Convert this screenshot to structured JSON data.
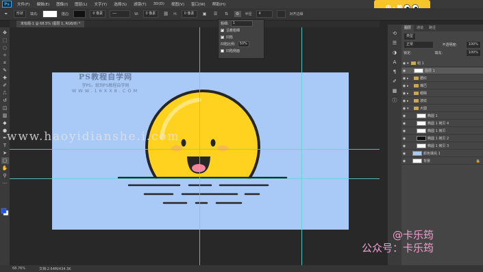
{
  "app": {
    "logo": "Ps"
  },
  "menu": [
    "文件(F)",
    "编辑(E)",
    "图像(I)",
    "图层(L)",
    "文字(Y)",
    "选择(S)",
    "滤镜(T)",
    "3D(D)",
    "视图(V)",
    "窗口(W)",
    "帮助(H)"
  ],
  "options_bar": {
    "shape_mode": "形状",
    "fill_label": "填充:",
    "stroke_label": "描边:",
    "stroke_size": "0 像素",
    "w_label": "W:",
    "w_value": "0 像素",
    "h_label": "H:",
    "h_value": "0 像素",
    "radius_label": "半径",
    "radius_value": "4",
    "align_edges": "对齐边缘"
  },
  "doc_tab": "未标题-1 @ 68.5% (图层 1, RGB/8) *",
  "path_options": {
    "title": "粗细:",
    "title_value": "1",
    "color_label": "颜色",
    "check_label": "沿着粗细",
    "check2_label": "凹陷",
    "field_label": "凹陷比例:",
    "field_value": "50%",
    "check3_label": "凹陷侧面"
  },
  "layers": {
    "tabs": [
      "图层",
      "通道",
      "路径"
    ],
    "kind_label": "类型",
    "blend_mode": "正常",
    "opacity_label": "不透明度:",
    "opacity_value": "100%",
    "lock_label": "锁定:",
    "fill_label": "填充:",
    "fill_value": "100%",
    "rows": [
      {
        "name": "组 1"
      },
      {
        "name": "图层 1"
      },
      {
        "name": "腮红"
      },
      {
        "name": "嘴巴"
      },
      {
        "name": "眼睛"
      },
      {
        "name": "波纹"
      },
      {
        "name": "大圆"
      },
      {
        "name": "椭圆 1"
      },
      {
        "name": "椭圆 1 拷贝 4"
      },
      {
        "name": "椭圆 1 拷贝"
      },
      {
        "name": "椭圆 1 拷贝 2"
      },
      {
        "name": "椭圆 1 拷贝 3"
      },
      {
        "name": "颜色填充 1"
      },
      {
        "name": "背景"
      }
    ]
  },
  "status": {
    "zoom": "68.76%",
    "doc": "文档:2.64M/434.3K"
  },
  "mascot_text": "中 · 简",
  "watermark_top": {
    "title": "PS教程自学网",
    "sub": "学PS，就到PS教程自学网",
    "url": "WWW.16XX8.COM"
  },
  "watermark_url": "www.haoyidianshe.i.com",
  "credit": {
    "line1": "@卡乐筠",
    "line2": "公众号：卡乐筠"
  },
  "colors": {
    "canvas_bg": "#a9caf6",
    "sun": "#ffd21f",
    "outline": "#262626",
    "tongue": "#f2859b",
    "accent": "#31a8ff",
    "fg": "#1e50ff",
    "bg": "#ffffff"
  }
}
